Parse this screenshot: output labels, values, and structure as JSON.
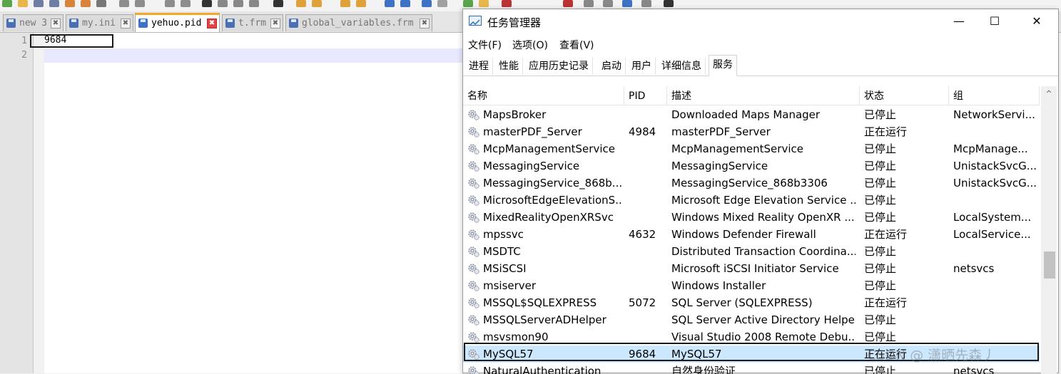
{
  "notepad": {
    "tabs": [
      {
        "label": "new 3",
        "active": false
      },
      {
        "label": "my.ini",
        "active": false
      },
      {
        "label": "yehuo.pid",
        "active": true
      },
      {
        "label": "t.frm",
        "active": false
      },
      {
        "label": "global_variables.frm",
        "active": false
      }
    ],
    "close_glyph": "✖",
    "lines": [
      {
        "number": "1",
        "text": "9684"
      },
      {
        "number": "2",
        "text": ""
      }
    ]
  },
  "taskmgr": {
    "title": "任务管理器",
    "window_controls": {
      "minimize": "—",
      "maximize": "☐",
      "close": "✕"
    },
    "menu": [
      "文件(F)",
      "选项(O)",
      "查看(V)"
    ],
    "tabs": [
      "进程",
      "性能",
      "应用历史记录",
      "启动",
      "用户",
      "详细信息",
      "服务"
    ],
    "active_tab": "服务",
    "columns": [
      "名称",
      "PID",
      "描述",
      "状态",
      "组"
    ],
    "sort_indicator": "^",
    "rows": [
      {
        "name": "MapsBroker",
        "pid": "",
        "desc": "Downloaded Maps Manager",
        "status": "已停止",
        "group": "NetworkServi..."
      },
      {
        "name": "masterPDF_Server",
        "pid": "4984",
        "desc": "masterPDF_Server",
        "status": "正在运行",
        "group": ""
      },
      {
        "name": "McpManagementService",
        "pid": "",
        "desc": "McpManagementService",
        "status": "已停止",
        "group": "McpManage..."
      },
      {
        "name": "MessagingService",
        "pid": "",
        "desc": "MessagingService",
        "status": "已停止",
        "group": "UnistackSvcG..."
      },
      {
        "name": "MessagingService_868b...",
        "pid": "",
        "desc": "MessagingService_868b3306",
        "status": "已停止",
        "group": "UnistackSvcG..."
      },
      {
        "name": "MicrosoftEdgeElevationS...",
        "pid": "",
        "desc": "Microsoft Edge Elevation Service ...",
        "status": "已停止",
        "group": ""
      },
      {
        "name": "MixedRealityOpenXRSvc",
        "pid": "",
        "desc": "Windows Mixed Reality OpenXR ...",
        "status": "已停止",
        "group": "LocalSystem..."
      },
      {
        "name": "mpssvc",
        "pid": "4632",
        "desc": "Windows Defender Firewall",
        "status": "正在运行",
        "group": "LocalService..."
      },
      {
        "name": "MSDTC",
        "pid": "",
        "desc": "Distributed Transaction Coordina...",
        "status": "已停止",
        "group": ""
      },
      {
        "name": "MSiSCSI",
        "pid": "",
        "desc": "Microsoft iSCSI Initiator Service",
        "status": "已停止",
        "group": "netsvcs"
      },
      {
        "name": "msiserver",
        "pid": "",
        "desc": "Windows Installer",
        "status": "已停止",
        "group": ""
      },
      {
        "name": "MSSQL$SQLEXPRESS",
        "pid": "5072",
        "desc": "SQL Server (SQLEXPRESS)",
        "status": "正在运行",
        "group": ""
      },
      {
        "name": "MSSQLServerADHelper",
        "pid": "",
        "desc": "SQL Server Active Directory Helper",
        "status": "已停止",
        "group": ""
      },
      {
        "name": "msvsmon90",
        "pid": "",
        "desc": "Visual Studio 2008 Remote Debu...",
        "status": "已停止",
        "group": ""
      },
      {
        "name": "MySQL57",
        "pid": "9684",
        "desc": "MySQL57",
        "status": "正在运行",
        "group": "",
        "selected": true
      },
      {
        "name": "NaturalAuthentication",
        "pid": "",
        "desc": "自然身份验证",
        "status": "已停止",
        "group": "netsvcs"
      }
    ],
    "scroll_up_glyph": "^"
  },
  "watermark": "CSDN @ 潇晒先森丿"
}
